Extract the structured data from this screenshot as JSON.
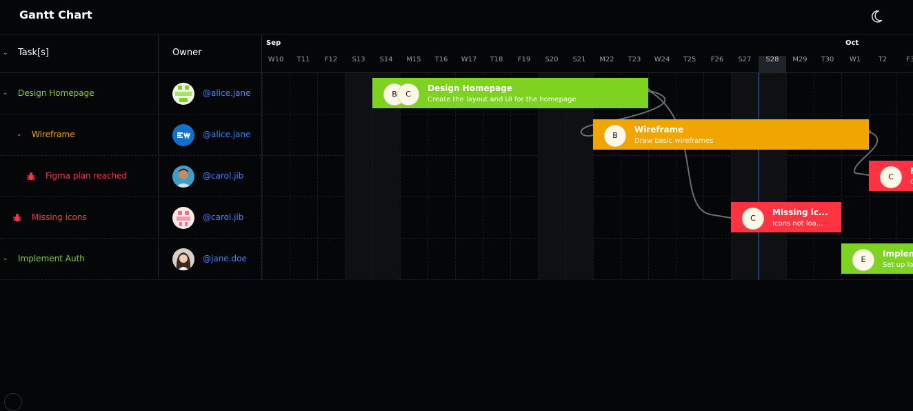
{
  "app": {
    "title": "Gantt Chart",
    "theme_icon": "moon-icon"
  },
  "columns": {
    "task_header": "Task[s]",
    "owner_header": "Owner"
  },
  "timeline": {
    "months": [
      {
        "label": "Sep"
      },
      {
        "label": "Oct"
      }
    ],
    "days": [
      "W10",
      "T11",
      "F12",
      "S13",
      "S14",
      "M15",
      "T16",
      "W17",
      "T18",
      "F19",
      "S20",
      "S21",
      "M22",
      "T23",
      "W24",
      "T25",
      "F26",
      "S27",
      "S28",
      "M29",
      "T30",
      "W1",
      "T2",
      "F3"
    ],
    "today": "S28"
  },
  "rows": [
    {
      "task": "Design Homepage",
      "color": "#7ed321",
      "icon": "chevron-down-icon",
      "owner": "@alice.jane",
      "avatar": "pixel-avatar-green"
    },
    {
      "task": "Wireframe",
      "color": "#f0a500",
      "icon": "chevron-down-icon",
      "owner": "@alice.jane",
      "avatar": "brand-avatar-blue"
    },
    {
      "task": "Figma plan reached",
      "color": "#ff3342",
      "icon": "bug-icon",
      "owner": "@carol.jib",
      "avatar": "photo-avatar-man"
    },
    {
      "task": "Missing icons",
      "color": "#ff3342",
      "icon": "bug-icon",
      "owner": "@carol.jib",
      "avatar": "pixel-avatar-pink"
    },
    {
      "task": "Implement Auth",
      "color": "#7ed321",
      "icon": "chevron-down-icon",
      "owner": "@jane.doe",
      "avatar": "photo-avatar-woman"
    }
  ],
  "bars": [
    {
      "title": "Design Homepage",
      "subtitle": "Create the layout and UI for the homepage",
      "assignees": [
        "B",
        "C"
      ],
      "color": "#7ed321",
      "start": "S14",
      "end": "W24"
    },
    {
      "title": "Wireframe",
      "subtitle": "Draw basic wireframes",
      "assignees": [
        "B"
      ],
      "color": "#f0a500",
      "start": "M22",
      "end": "W1"
    },
    {
      "title": "F",
      "subtitle": "C",
      "assignees": [
        "C"
      ],
      "color": "#ff3342",
      "start": "T2",
      "end": "F3"
    },
    {
      "title": "Missing ic...",
      "subtitle": "Icons not loa...",
      "assignees": [
        "C"
      ],
      "color": "#ff3342",
      "start": "S27",
      "end": "T30"
    },
    {
      "title": "Implem",
      "subtitle": "Set up lo",
      "assignees": [
        "E"
      ],
      "color": "#7ed321",
      "start": "W1",
      "end": "F3"
    }
  ]
}
